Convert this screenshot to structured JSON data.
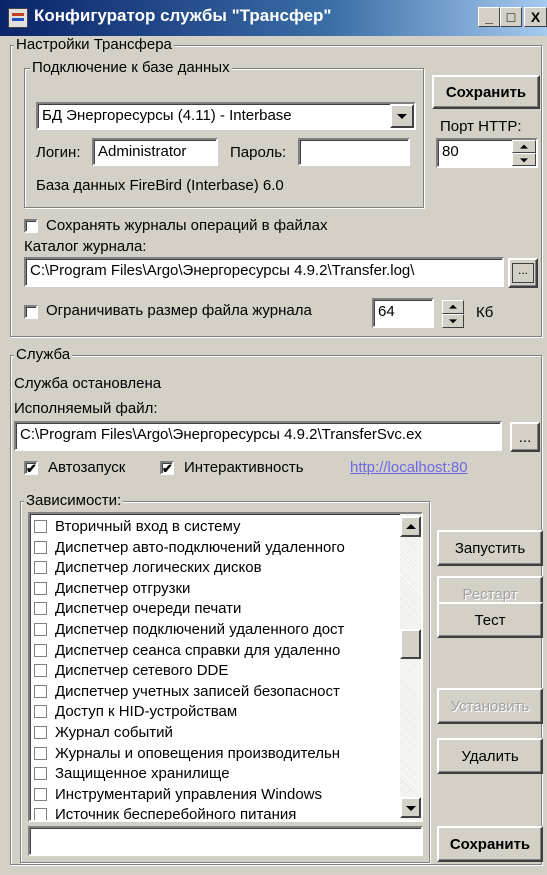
{
  "window": {
    "title": "Конфигуратор службы \"Трансфер\"",
    "buttons": {
      "minimize": "_",
      "maximize": "□",
      "close": "X"
    }
  },
  "transfer": {
    "group_label": "Настройки Трансфера",
    "db": {
      "group_label": "Подключение к базе данных",
      "selected": "БД Энергоресурсы (4.11) - Interbase",
      "login_label": "Логин:",
      "login_value": "Administrator",
      "password_label": "Пароль:",
      "password_value": "",
      "db_info": "База данных FireBird (Interbase) 6.0"
    },
    "save_label": "Сохранить",
    "port_label": "Порт HTTP:",
    "port_value": "80",
    "save_logs_label": "Сохранять журналы операций в файлах",
    "save_logs_checked": false,
    "log_dir_label": "Каталог журнала:",
    "log_dir_value": "C:\\Program Files\\Argo\\Энергоресурсы 4.9.2\\Transfer.log\\",
    "browse_label": "...",
    "limit_label": "Ограничивать размер файла журнала",
    "limit_checked": false,
    "limit_value": "64",
    "limit_unit": "Кб"
  },
  "service": {
    "group_label": "Служба",
    "status": "Служба остановлена",
    "exe_label": "Исполняемый файл:",
    "exe_value": "C:\\Program Files\\Argo\\Энергоресурсы 4.9.2\\TransferSvc.ex",
    "browse_label": "...",
    "autostart_label": "Автозапуск",
    "autostart_checked": true,
    "interactive_label": "Интерактивность",
    "interactive_checked": true,
    "url": "http://localhost:80",
    "deps_label": "Зависимости:",
    "deps": [
      "Вторичный вход в систему",
      "Диспетчер авто-подключений удаленного",
      "Диспетчер логических дисков",
      "Диспетчер отгрузки",
      "Диспетчер очереди печати",
      "Диспетчер подключений удаленного дост",
      "Диспетчер сеанса справки для удаленно",
      "Диспетчер сетевого DDE",
      "Диспетчер учетных записей безопасност",
      "Доступ к HID-устройствам",
      "Журнал событий",
      "Журналы и оповещения производительн",
      "Защищенное хранилище",
      "Инструментарий управления Windows",
      "Источник бесперебойного питания"
    ],
    "deps_input_value": "",
    "buttons": {
      "start": "Запустить",
      "restart": "Рестарт",
      "test": "Тест",
      "install": "Установить",
      "delete": "Удалить",
      "save": "Сохранить"
    }
  }
}
